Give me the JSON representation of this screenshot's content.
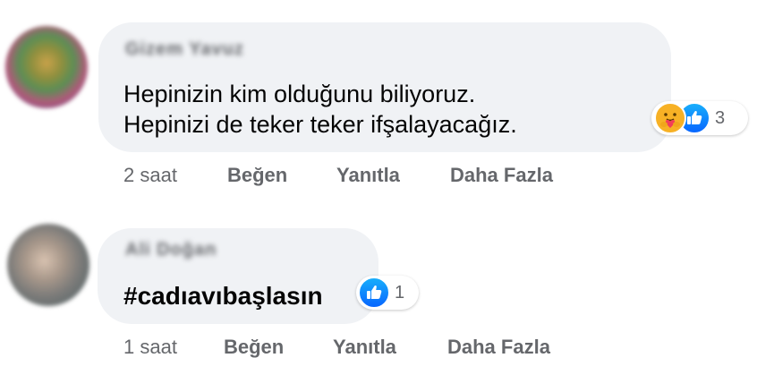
{
  "comments": [
    {
      "author": "Gizem Yavuz",
      "lines": [
        "Hepinizin kim olduğunu biliyoruz.",
        "Hepinizi de teker teker ifşalayacağız."
      ],
      "reaction_count": "3",
      "reaction_icons": [
        "care-icon",
        "like-icon"
      ],
      "time": "2 saat",
      "like_label": "Beğen",
      "reply_label": "Yanıtla",
      "more_label": "Daha Fazla"
    },
    {
      "author": "Ali Doğan",
      "lines": [
        "#cadıavıbaşlasın"
      ],
      "reaction_count": "1",
      "reaction_icons": [
        "like-icon"
      ],
      "time": "1 saat",
      "like_label": "Beğen",
      "reply_label": "Yanıtla",
      "more_label": "Daha Fazla"
    }
  ],
  "colors": {
    "bubble": "#f0f2f5",
    "text": "#050505",
    "secondary_text": "#65676b",
    "like_blue": "#0866ff",
    "care_yellow": "#f7b125"
  }
}
